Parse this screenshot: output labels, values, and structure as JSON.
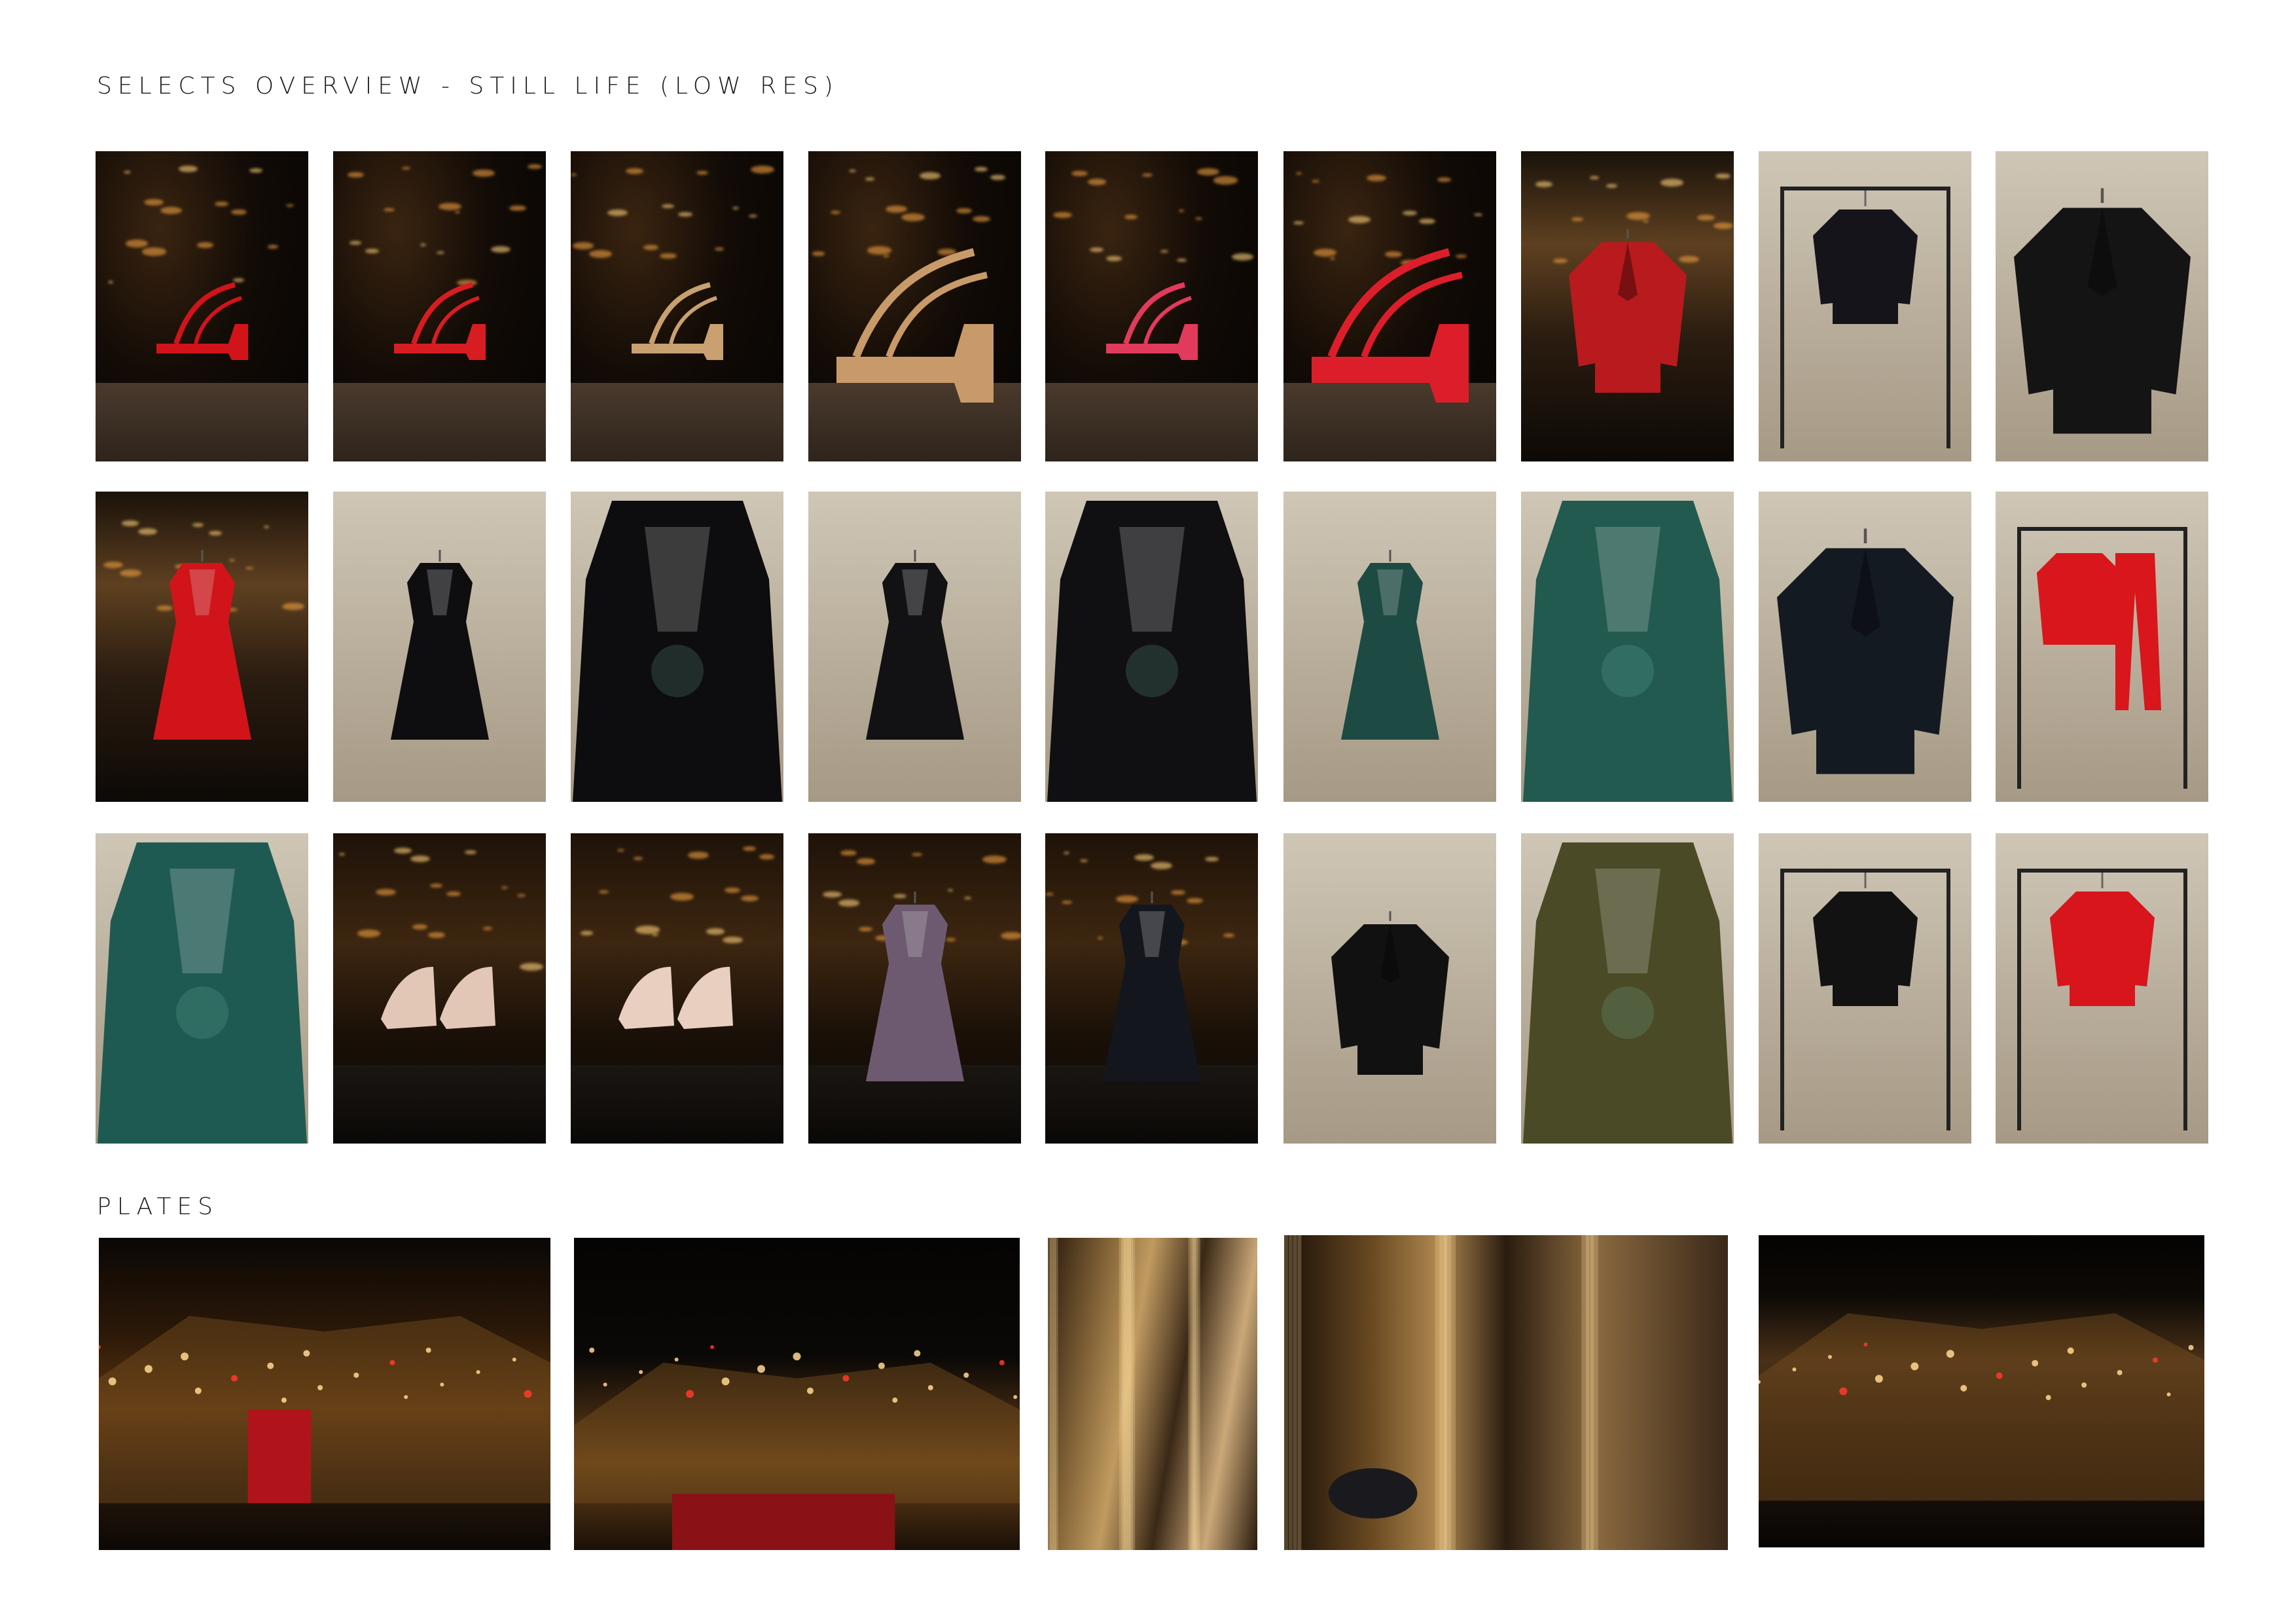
{
  "page": {
    "title": "SELECTS OVERVIEW - STILL LIFE (LOW RES)",
    "plates_title": "PLATES"
  },
  "grid": {
    "rows": [
      [
        {
          "name": "red-platform-sandal-night",
          "scene": "night",
          "subject": "shoe",
          "color": "#d2131a"
        },
        {
          "name": "red-platform-sandal-night-2",
          "scene": "night",
          "subject": "shoe",
          "color": "#d81d22"
        },
        {
          "name": "gold-strappy-sandal",
          "scene": "night",
          "subject": "shoe",
          "color": "#c9a070"
        },
        {
          "name": "gold-strappy-sandal-closeup",
          "scene": "night",
          "subject": "shoe-close",
          "color": "#c89a6a"
        },
        {
          "name": "pink-strappy-sandal",
          "scene": "night",
          "subject": "shoe",
          "color": "#e23a5c"
        },
        {
          "name": "red-sandal-closeup",
          "scene": "night",
          "subject": "shoe-close",
          "color": "#dc1e2a"
        },
        {
          "name": "red-leather-blazer-gallery",
          "scene": "building",
          "subject": "jacket",
          "color": "#b81a1e"
        },
        {
          "name": "embroidered-cropped-jacket-rail",
          "scene": "wall",
          "subject": "jacket-small",
          "color": "#15141a"
        },
        {
          "name": "quilted-leather-jacket",
          "scene": "wall",
          "subject": "jacket-large",
          "color": "#141414"
        }
      ],
      [
        {
          "name": "red-belted-dress-gallery",
          "scene": "building",
          "subject": "dress",
          "color": "#d0141a"
        },
        {
          "name": "black-embellished-velvet-dress",
          "scene": "wall",
          "subject": "dress",
          "color": "#0e0d0f"
        },
        {
          "name": "black-embellished-dress-detail",
          "scene": "wall",
          "subject": "dress-close",
          "color": "#0d0c0e"
        },
        {
          "name": "black-embroidered-sleeve-dress",
          "scene": "wall",
          "subject": "dress",
          "color": "#121114"
        },
        {
          "name": "black-embroidered-sleeve-detail",
          "scene": "wall",
          "subject": "dress-close",
          "color": "#101012"
        },
        {
          "name": "green-floral-lace-dress",
          "scene": "wall",
          "subject": "dress",
          "color": "#1d4a43"
        },
        {
          "name": "green-floral-lace-detail",
          "scene": "wall",
          "subject": "dress-close",
          "color": "#225a50"
        },
        {
          "name": "embroidered-jacket-detail",
          "scene": "wall",
          "subject": "jacket-large",
          "color": "#141a22"
        },
        {
          "name": "red-satin-suit-rail",
          "scene": "wall",
          "subject": "suit",
          "color": "#d8161c"
        }
      ],
      [
        {
          "name": "green-lace-hem-detail",
          "scene": "wall",
          "subject": "dress-close",
          "color": "#1f5a52"
        },
        {
          "name": "nude-pumps-fountain",
          "scene": "night-city",
          "subject": "pumps",
          "color": "#e3c7b6"
        },
        {
          "name": "nude-pumps-fountain-2",
          "scene": "night-city",
          "subject": "pumps",
          "color": "#e8cfc0"
        },
        {
          "name": "sequin-dress-night",
          "scene": "night-city",
          "subject": "dress",
          "color": "#6e5a70"
        },
        {
          "name": "feather-hem-velvet-dress-street",
          "scene": "night-city",
          "subject": "dress",
          "color": "#14161e"
        },
        {
          "name": "black-lace-trim-coat-rail",
          "scene": "wall",
          "subject": "jacket",
          "color": "#111111"
        },
        {
          "name": "khaki-studded-dress",
          "scene": "wall",
          "subject": "dress-close",
          "color": "#4a4a26"
        },
        {
          "name": "black-quilted-biker-jacket-rail",
          "scene": "wall",
          "subject": "jacket-small",
          "color": "#121212"
        },
        {
          "name": "red-blazer-rail",
          "scene": "wall",
          "subject": "jacket-small",
          "color": "#d8141c"
        }
      ]
    ]
  },
  "plates": [
    {
      "name": "trafalgar-square-bus-night",
      "tone": "warm-street"
    },
    {
      "name": "grand-building-facade-night",
      "tone": "facade"
    },
    {
      "name": "motion-blur-street-vertical",
      "tone": "blur"
    },
    {
      "name": "motion-blur-street-car",
      "tone": "blur-wide"
    },
    {
      "name": "corner-building-street-lights",
      "tone": "corner"
    }
  ]
}
